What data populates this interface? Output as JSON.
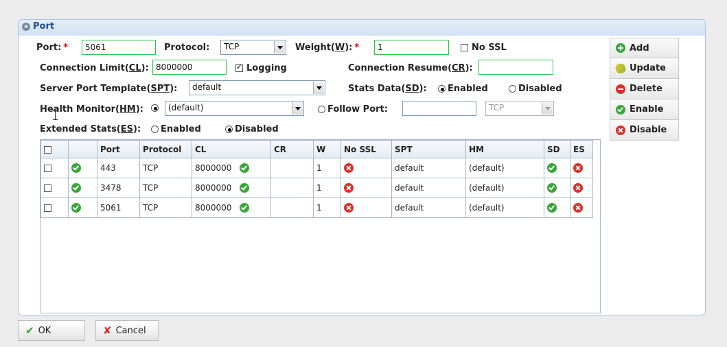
{
  "panel": {
    "title": "Port"
  },
  "form": {
    "port_label": "Port:",
    "port_value": "5061",
    "protocol_label": "Protocol:",
    "protocol_value": "TCP",
    "weight_label_pre": "Weight(",
    "weight_label_key": "W",
    "weight_label_post": "):",
    "weight_value": "1",
    "nossl_label": "No SSL",
    "connlimit_label_pre": "Connection Limit(",
    "connlimit_label_key": "CL",
    "connlimit_label_post": "):",
    "connlimit_value": "8000000",
    "logging_label": "Logging",
    "connresume_label_pre": "Connection Resume(",
    "connresume_label_key": "CR",
    "connresume_label_post": "):",
    "connresume_value": "",
    "spt_label_pre": "Server Port Template(",
    "spt_label_key": "SPT",
    "spt_label_post": "):",
    "spt_value": "default",
    "statsdata_label_pre": "Stats Data(",
    "statsdata_label_key": "SD",
    "statsdata_label_post": "):",
    "statsdata_enabled": "Enabled",
    "statsdata_disabled": "Disabled",
    "hm_label_pre": "Health Monitor(",
    "hm_label_key": "HM",
    "hm_label_post": "):",
    "hm_value": "(default)",
    "followport_label": "Follow Port:",
    "followport_value": "",
    "followport_protocol": "TCP",
    "es_label_pre": "Extended Stats(",
    "es_label_key": "ES",
    "es_label_post": "):",
    "es_enabled": "Enabled",
    "es_disabled": "Disabled"
  },
  "table": {
    "headers": [
      "",
      "",
      "Port",
      "Protocol",
      "CL",
      "CR",
      "W",
      "No SSL",
      "SPT",
      "HM",
      "SD",
      "ES"
    ],
    "rows": [
      {
        "port": "443",
        "protocol": "TCP",
        "cl": "8000000",
        "cr": "",
        "w": "1",
        "spt": "default",
        "hm": "(default)"
      },
      {
        "port": "3478",
        "protocol": "TCP",
        "cl": "8000000",
        "cr": "",
        "w": "1",
        "spt": "default",
        "hm": "(default)"
      },
      {
        "port": "5061",
        "protocol": "TCP",
        "cl": "8000000",
        "cr": "",
        "w": "1",
        "spt": "default",
        "hm": "(default)"
      }
    ]
  },
  "side_buttons": {
    "add": "Add",
    "update": "Update",
    "delete": "Delete",
    "enable": "Enable",
    "disable": "Disable"
  },
  "footer": {
    "ok": "OK",
    "cancel": "Cancel"
  },
  "colors": {
    "panel_border": "#a7c4e6",
    "title_blue": "#1f4f94",
    "required_red": "#d00000",
    "field_green": "#27c93f",
    "ok_green": "#3aa63a",
    "err_red": "#d9302b"
  }
}
